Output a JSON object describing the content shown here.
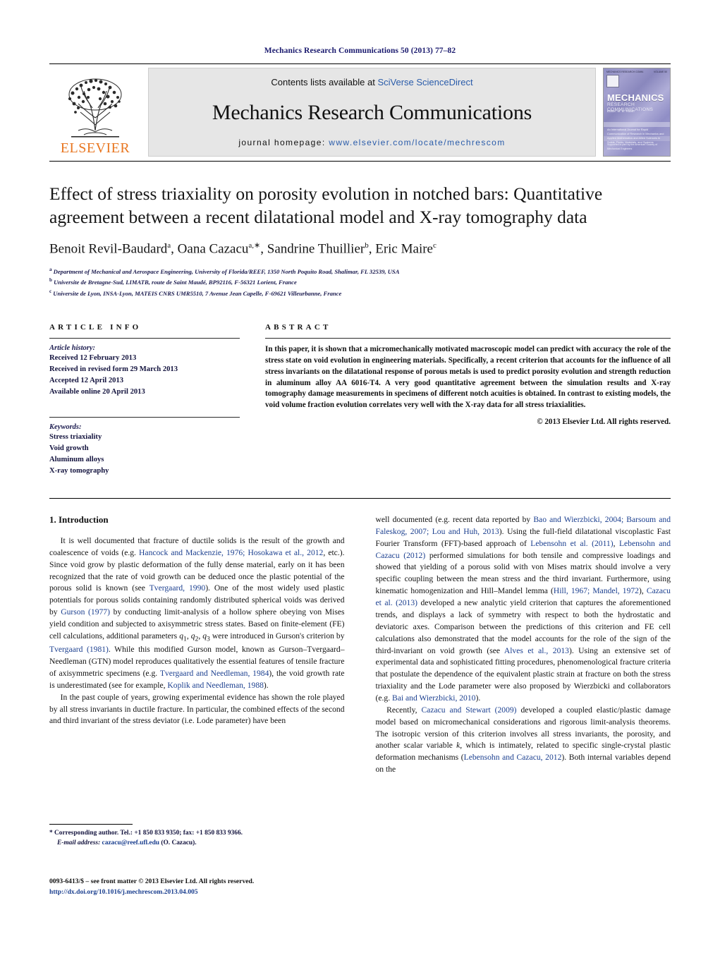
{
  "running_head": "Mechanics Research Communications 50 (2013) 77–82",
  "masthead": {
    "contents_prefix": "Contents lists available at ",
    "contents_link": "SciVerse ScienceDirect",
    "journal_title": "Mechanics Research Communications",
    "homepage_prefix": "journal homepage: ",
    "homepage_url": "www.elsevier.com/locate/mechrescom",
    "publisher": "ELSEVIER",
    "link_color": "#2a5caa"
  },
  "cover": {
    "top_left": "MECHANICS RESEARCH COMM.",
    "top_right": "VOLUME 50",
    "issue": "edited by",
    "title": "MECHANICS",
    "subtitle": "RESEARCH COMMUNICATIONS",
    "editor": "Editor: M. B. Rubin",
    "body": "An International Journal for Rapid Communication of Research\nin Mechanics and Applied Mathematics and Allied Sciences\nin Solids, Fluids, Materials, and Systems",
    "foot": "Supported in part by\nthe American Society of Mechanical Engineers"
  },
  "article": {
    "title": "Effect of stress triaxiality on porosity evolution in notched bars: Quantitative agreement between a recent dilatational model and X-ray tomography data",
    "authors_html": "Benoit Revil-Baudard<sup>a</sup>, Oana Cazacu<sup>a,∗</sup>, Sandrine Thuillier<sup>b</sup>, Eric Maire<sup>c</sup>",
    "affiliations": [
      {
        "mark": "a",
        "text": "Department of Mechanical and Aerospace Engineering, University of Florida/REEF, 1350 North Poquito Road, Shalimar, FL 32539, USA"
      },
      {
        "mark": "b",
        "text": "Universite de Bretagne-Sud, LIMATB, route de Saint Maudé, BP92116, F-56321 Lorient, France"
      },
      {
        "mark": "c",
        "text": "Universite de Lyon, INSA-Lyon, MATEIS CNRS UMR5510, 7 Avenue Jean Capelle, F-69621 Villeurbanne, France"
      }
    ]
  },
  "info": {
    "label": "ARTICLE INFO",
    "history_head": "Article history:",
    "history": [
      "Received 12 February 2013",
      "Received in revised form 29 March 2013",
      "Accepted 12 April 2013",
      "Available online 20 April 2013"
    ],
    "keywords_head": "Keywords:",
    "keywords": [
      "Stress triaxiality",
      "Void growth",
      "Aluminum alloys",
      "X-ray tomography"
    ]
  },
  "abstract": {
    "label": "ABSTRACT",
    "text": "In this paper, it is shown that a micromechanically motivated macroscopic model can predict with accuracy the role of the stress state on void evolution in engineering materials. Specifically, a recent criterion that accounts for the influence of all stress invariants on the dilatational response of porous metals is used to predict porosity evolution and strength reduction in aluminum alloy AA 6016-T4. A very good quantitative agreement between the simulation results and X-ray tomography damage measurements in specimens of different notch acuities is obtained. In contrast to existing models, the void volume fraction evolution correlates very well with the X-ray data for all stress triaxialities.",
    "copyright": "© 2013 Elsevier Ltd. All rights reserved."
  },
  "body": {
    "section1_heading": "1. Introduction",
    "left_paragraphs": [
      "It is well documented that fracture of ductile solids is the result of the growth and coalescence of voids (e.g. <span class=\"cit\">Hancock and Mackenzie, 1976; Hosokawa et al., 2012</span>, etc.). Since void grow by plastic deformation of the fully dense material, early on it has been recognized that the rate of void growth can be deduced once the plastic potential of the porous solid is known (see <span class=\"cit\">Tvergaard, 1990</span>). One of the most widely used plastic potentials for porous solids containing randomly distributed spherical voids was derived by <span class=\"cit\">Gurson (1977)</span> by conducting limit-analysis of a hollow sphere obeying von Mises yield condition and subjected to axisymmetric stress states. Based on finite-element (FE) cell calculations, additional parameters <var>q</var><sub>1</sub>, <var>q</var><sub>2</sub>, <var>q</var><sub>3</sub> were introduced in Gurson's criterion by <span class=\"cit\">Tvergaard (1981)</span>. While this modified Gurson model, known as Gurson–Tvergaard–Needleman (GTN) model reproduces qualitatively the essential features of tensile fracture of axisymmetric specimens (e.g. <span class=\"cit\">Tvergaard and Needleman, 1984</span>), the void growth rate is underestimated (see for example, <span class=\"cit\">Koplik and Needleman, 1988</span>).",
      "In the past couple of years, growing experimental evidence has shown the role played by all stress invariants in ductile fracture. In particular, the combined effects of the second and third invariant of the stress deviator (i.e. Lode parameter) have been"
    ],
    "right_paragraphs": [
      "well documented (e.g. recent data reported by <span class=\"cit\">Bao and Wierzbicki, 2004; Barsoum and Faleskog, 2007; Lou and Huh, 2013</span>). Using the full-field dilatational viscoplastic Fast Fourier Transform (FFT)-based approach of <span class=\"cit\">Lebensohn et al. (2011)</span>, <span class=\"cit\">Lebensohn and Cazacu (2012)</span> performed simulations for both tensile and compressive loadings and showed that yielding of a porous solid with von Mises matrix should involve a very specific coupling between the mean stress and the third invariant. Furthermore, using kinematic homogenization and Hill–Mandel lemma (<span class=\"cit\">Hill, 1967; Mandel, 1972</span>), <span class=\"cit\">Cazacu et al. (2013)</span> developed a new analytic yield criterion that captures the aforementioned trends, and displays a lack of symmetry with respect to both the hydrostatic and deviatoric axes. Comparison between the predictions of this criterion and FE cell calculations also demonstrated that the model accounts for the role of the sign of the third-invariant on void growth (see <span class=\"cit\">Alves et al., 2013</span>). Using an extensive set of experimental data and sophisticated fitting procedures, phenomenological fracture criteria that postulate the dependence of the equivalent plastic strain at fracture on both the stress triaxiality and the Lode parameter were also proposed by Wierzbicki and collaborators (e.g. <span class=\"cit\">Bai and Wierzbicki, 2010</span>).",
      "Recently, <span class=\"cit\">Cazacu and Stewart (2009)</span> developed a coupled elastic/plastic damage model based on micromechanical considerations and rigorous limit-analysis theorems. The isotropic version of this criterion involves all stress invariants, the porosity, and another scalar variable <var>k</var>, which is intimately, related to specific single-crystal plastic deformation mechanisms (<span class=\"cit\">Lebensohn and Cazacu, 2012</span>). Both internal variables depend on the"
    ]
  },
  "footnotes": {
    "corresponding": "* Corresponding author. Tel.: +1 850 833 9350; fax: +1 850 833 9366.",
    "email_label": "E-mail address:",
    "email": "cazacu@reef.ufl.edu",
    "email_suffix": "(O. Cazacu)."
  },
  "imprint": {
    "line1": "0093-6413/$ – see front matter © 2013 Elsevier Ltd. All rights reserved.",
    "doi": "http://dx.doi.org/10.1016/j.mechrescom.2013.04.005"
  }
}
